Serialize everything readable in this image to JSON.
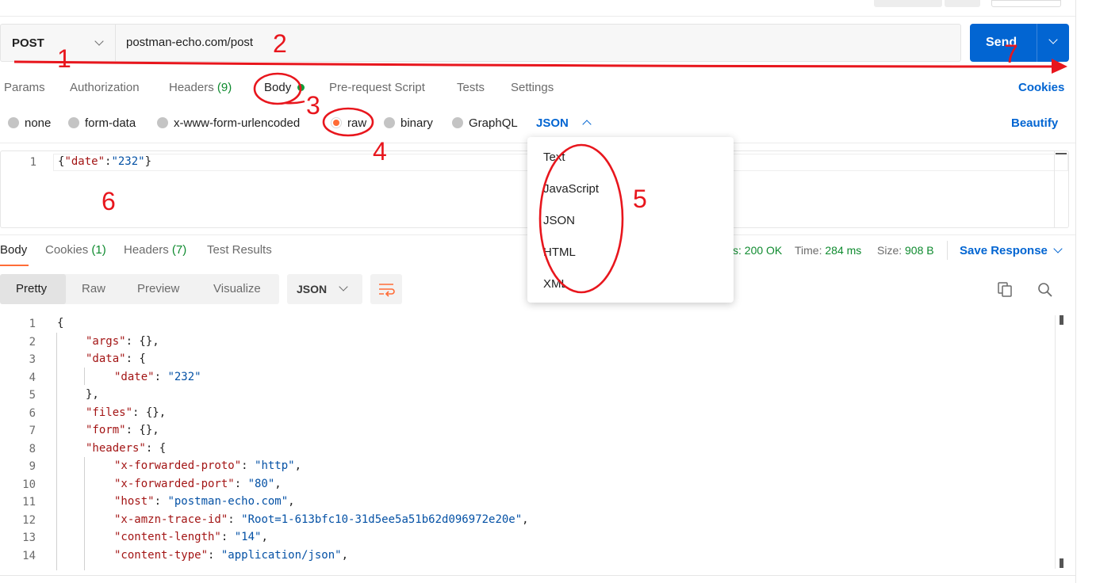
{
  "request": {
    "method": "POST",
    "url": "postman-echo.com/post",
    "send_label": "Send"
  },
  "request_tabs": [
    {
      "label": "Params"
    },
    {
      "label": "Authorization"
    },
    {
      "label": "Headers",
      "count": "(9)"
    },
    {
      "label": "Body"
    },
    {
      "label": "Pre-request Script"
    },
    {
      "label": "Tests"
    },
    {
      "label": "Settings"
    }
  ],
  "cookies_link": "Cookies",
  "body_types": [
    {
      "label": "none",
      "selected": false
    },
    {
      "label": "form-data",
      "selected": false
    },
    {
      "label": "x-www-form-urlencoded",
      "selected": false
    },
    {
      "label": "raw",
      "selected": true
    },
    {
      "label": "binary",
      "selected": false
    },
    {
      "label": "GraphQL",
      "selected": false
    }
  ],
  "raw_format": "JSON",
  "beautify_label": "Beautify",
  "request_body": {
    "line_number": "1",
    "open": "{",
    "key": "\"date\"",
    "colon": ":",
    "value": "\"232\"",
    "close": "}"
  },
  "format_dropdown": {
    "options": [
      "Text",
      "JavaScript",
      "JSON",
      "HTML",
      "XML"
    ]
  },
  "response_tabs": [
    {
      "label": "Body"
    },
    {
      "label": "Cookies",
      "count": "(1)"
    },
    {
      "label": "Headers",
      "count": "(7)"
    },
    {
      "label": "Test Results"
    }
  ],
  "response_status": {
    "status_prefix": "s:",
    "status_value": "200 OK",
    "time_label": "Time:",
    "time_value": "284 ms",
    "size_label": "Size:",
    "size_value": "908 B"
  },
  "save_response_label": "Save Response",
  "view_modes": [
    "Pretty",
    "Raw",
    "Preview",
    "Visualize"
  ],
  "response_format": "JSON",
  "response_lines": [
    {
      "n": "1",
      "indent": 0,
      "parts": [
        [
          "p",
          "{"
        ]
      ]
    },
    {
      "n": "2",
      "indent": 1,
      "parts": [
        [
          "k",
          "\"args\""
        ],
        [
          "p",
          ": {},"
        ]
      ]
    },
    {
      "n": "3",
      "indent": 1,
      "parts": [
        [
          "k",
          "\"data\""
        ],
        [
          "p",
          ": {"
        ]
      ]
    },
    {
      "n": "4",
      "indent": 2,
      "parts": [
        [
          "k",
          "\"date\""
        ],
        [
          "p",
          ": "
        ],
        [
          "s",
          "\"232\""
        ]
      ]
    },
    {
      "n": "5",
      "indent": 1,
      "parts": [
        [
          "p",
          "},"
        ]
      ]
    },
    {
      "n": "6",
      "indent": 1,
      "parts": [
        [
          "k",
          "\"files\""
        ],
        [
          "p",
          ": {},"
        ]
      ]
    },
    {
      "n": "7",
      "indent": 1,
      "parts": [
        [
          "k",
          "\"form\""
        ],
        [
          "p",
          ": {},"
        ]
      ]
    },
    {
      "n": "8",
      "indent": 1,
      "parts": [
        [
          "k",
          "\"headers\""
        ],
        [
          "p",
          ": {"
        ]
      ]
    },
    {
      "n": "9",
      "indent": 2,
      "parts": [
        [
          "k",
          "\"x-forwarded-proto\""
        ],
        [
          "p",
          ": "
        ],
        [
          "s",
          "\"http\""
        ],
        [
          "p",
          ","
        ]
      ]
    },
    {
      "n": "10",
      "indent": 2,
      "parts": [
        [
          "k",
          "\"x-forwarded-port\""
        ],
        [
          "p",
          ": "
        ],
        [
          "s",
          "\"80\""
        ],
        [
          "p",
          ","
        ]
      ]
    },
    {
      "n": "11",
      "indent": 2,
      "parts": [
        [
          "k",
          "\"host\""
        ],
        [
          "p",
          ": "
        ],
        [
          "s",
          "\"postman-echo.com\""
        ],
        [
          "p",
          ","
        ]
      ]
    },
    {
      "n": "12",
      "indent": 2,
      "parts": [
        [
          "k",
          "\"x-amzn-trace-id\""
        ],
        [
          "p",
          ": "
        ],
        [
          "s",
          "\"Root=1-613bfc10-31d5ee5a51b62d096972e20e\""
        ],
        [
          "p",
          ","
        ]
      ]
    },
    {
      "n": "13",
      "indent": 2,
      "parts": [
        [
          "k",
          "\"content-length\""
        ],
        [
          "p",
          ": "
        ],
        [
          "s",
          "\"14\""
        ],
        [
          "p",
          ","
        ]
      ]
    },
    {
      "n": "14",
      "indent": 2,
      "parts": [
        [
          "k",
          "\"content-type\""
        ],
        [
          "p",
          ": "
        ],
        [
          "s",
          "\"application/json\""
        ],
        [
          "p",
          ","
        ]
      ]
    }
  ],
  "annotations": [
    "1",
    "2",
    "3",
    "4",
    "5",
    "6",
    "7"
  ],
  "colors": {
    "accent_orange": "#ff6c37",
    "link_blue": "#0265d2",
    "annotation_red": "#e8161d",
    "count_green": "#0e8a2e"
  },
  "icons": [
    "chevron-down-icon",
    "chevron-up-icon",
    "wrap-lines-icon",
    "copy-icon",
    "search-icon"
  ]
}
